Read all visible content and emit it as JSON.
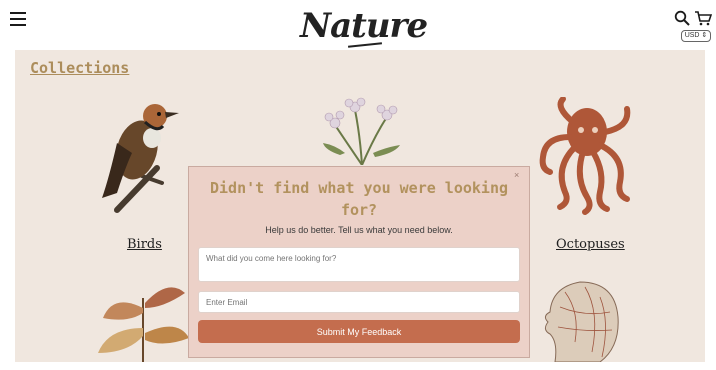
{
  "header": {
    "logo": "Nature",
    "currency": "USD ⇕"
  },
  "collections": {
    "title": "Collections",
    "items": [
      {
        "label": "Birds"
      },
      {
        "label": "Octopuses"
      }
    ]
  },
  "modal": {
    "close": "×",
    "title": "Didn't find what you were looking for?",
    "subtitle": "Help us do better. Tell us what you need below.",
    "query_placeholder": "What did you come here looking for?",
    "email_placeholder": "Enter Email",
    "submit_label": "Submit My Feedback"
  },
  "colors": {
    "accent": "#b2925e",
    "button": "#c46d4e",
    "modal_bg": "#ecd1c8",
    "page_bg": "#f8efe7"
  }
}
